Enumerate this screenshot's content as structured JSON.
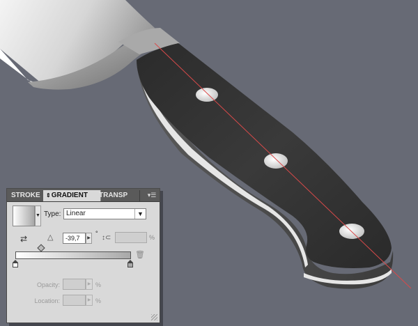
{
  "canvas": {
    "background": "#676a75",
    "guide_line_color": "#d94a4a"
  },
  "panel": {
    "tabs": [
      {
        "label": "STROKE",
        "active": false
      },
      {
        "label": "GRADIENT",
        "active": true
      },
      {
        "label": "TRANSP",
        "active": false
      }
    ],
    "menu_icon": "panel-menu-icon",
    "tab_sort_glyph": "⇕",
    "type_label": "Type:",
    "type_value": "Linear",
    "type_dropdown_glyph": "▼",
    "swatch_dropdown_glyph": "▼",
    "reverse_glyph": "⇄",
    "angle_glyph": "△",
    "angle_value": "-39,7",
    "angle_unit": "°",
    "stepper_glyph": "▶",
    "aspect_glyph": "↕⊂",
    "aspect_value": "",
    "aspect_unit": "%",
    "gradient_start": "#ffffff",
    "gradient_end": "#a8a8a8",
    "trash_glyph": "🗑",
    "opacity_label": "Opacity:",
    "opacity_value": "",
    "opacity_unit": "%",
    "location_label": "Location:",
    "location_value": "",
    "location_unit": "%"
  }
}
